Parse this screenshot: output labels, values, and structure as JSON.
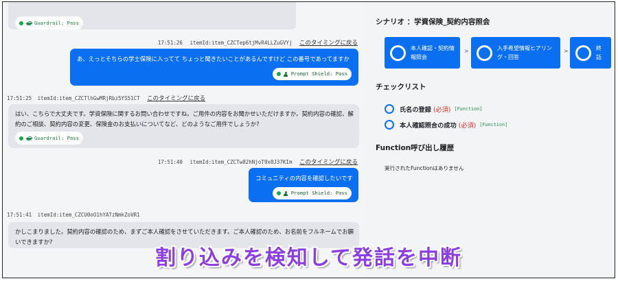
{
  "chat": {
    "messages": [
      {
        "role": "assistant",
        "pill": "Guardrail: Pass"
      },
      {
        "role": "user",
        "time": "17:51:26",
        "item": "itemId:item_CZCTep6tjMvR4LLZuGVYj",
        "back": "このタイミングに戻る",
        "text": "あ、えっとそちらの学士保険に入ってて ちょっと聞きたいことがあるんですけど この番号であってますか",
        "pill": "Prompt Shield: Pass"
      },
      {
        "role": "assistant",
        "time": "17:51:25",
        "item": "itemId:item_CZCTlhGwMRjRbz5YS51CT",
        "back": "このタイミングに戻る",
        "text_line1": "はい、こちらで大丈夫です。学資保険に関するお問い合わせですね。ご用件の内容をお聞かせいただけますか。契約内容の確認、解",
        "text_line2": "約のご相談、契約内容の変更、保険金のお支払いについてなど、どのようなご用件でしょうか?",
        "pill": "Guardrail: Pass"
      },
      {
        "role": "user",
        "time": "17:51:40",
        "item": "itemId:item_CZCTw82hNjoT9x8J37KIm",
        "back": "このタイミングに戻る",
        "text": "コミュニティの内容を確認したいです",
        "pill": "Prompt Shield: Pass"
      },
      {
        "role": "assistant",
        "time": "17:51:41",
        "item": "itemId:item_CZCU0oO1hYATzNmkZoVR1",
        "text_line1": "かしこまりました。契約内容の確認のため、まずご本人確認をさせていただきます。ご本人確認のため、お名前をフルネームでお願",
        "text_line2": "いできますか?"
      }
    ]
  },
  "scenario": {
    "title": "シナリオ ：学資保険_契約内容照会",
    "steps": [
      {
        "line1": "本人確認・契約情",
        "line2": "報照会"
      },
      {
        "line1": "入手希望情報ヒアリン",
        "line2": "グ・回答"
      },
      {
        "line1": "終",
        "line2": "話"
      }
    ],
    "arrow": ">"
  },
  "checklist": {
    "title": "チェックリスト",
    "items": [
      {
        "label": "氏名の登録",
        "required": "(必須)",
        "tag": "[Function]"
      },
      {
        "label": "本人確認照合の成功",
        "required": "(必須)",
        "tag": "[Function]"
      }
    ]
  },
  "function_history": {
    "title": "Function呼び出し履歴",
    "empty": "実行されたFunctionはありません"
  },
  "caption": "割り込みを検知して発話を中断",
  "colors": {
    "accent": "#0a6ff0",
    "pass_green": "#19a64a",
    "required_red": "#d93025",
    "caption_purple": "#8b3fe0"
  }
}
